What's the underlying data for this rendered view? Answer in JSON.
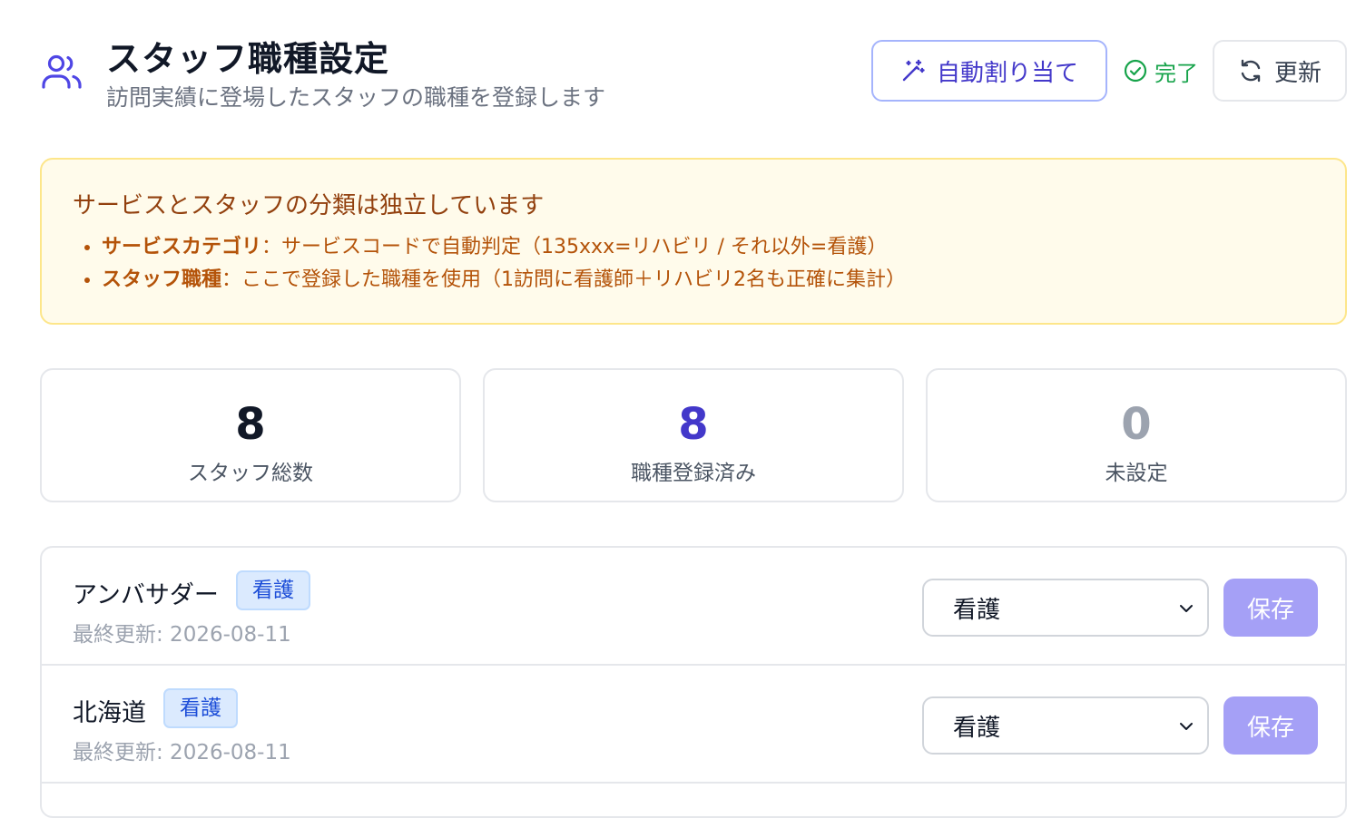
{
  "header": {
    "title": "スタッフ職種設定",
    "subtitle": "訪問実績に登場したスタッフの職種を登録します",
    "auto_assign_label": "自動割り当て",
    "status_text": "完了",
    "refresh_label": "更新"
  },
  "info": {
    "title": "サービスとスタッフの分類は独立しています",
    "items": [
      {
        "term": "サービスカテゴリ",
        "sep": "：",
        "desc": "サービスコードで自動判定（135xxx=リハビリ / それ以外=看護）"
      },
      {
        "term": "スタッフ職種",
        "sep": "：",
        "desc": "ここで登録した職種を使用（1訪問に看護師＋リハビリ2名も正確に集計）"
      }
    ]
  },
  "stats": [
    {
      "value": "8",
      "label": "スタッフ総数",
      "color": "#111827"
    },
    {
      "value": "8",
      "label": "職種登録済み",
      "color": "#4338ca"
    },
    {
      "value": "0",
      "label": "未設定",
      "color": "#9ca3af"
    }
  ],
  "staff": [
    {
      "name": "アンバサダー",
      "badge": "看護",
      "updated": "最終更新: 2026-08-11",
      "selected": "看護",
      "save_label": "保存"
    },
    {
      "name": "北海道",
      "badge": "看護",
      "updated": "最終更新: 2026-08-11",
      "selected": "看護",
      "save_label": "保存"
    }
  ],
  "colors": {
    "accent": "#4f46e5",
    "success": "#16a34a",
    "warning_bg": "#fffbeb",
    "warning_text": "#b45309",
    "save_disabled": "#a5a0f6"
  },
  "icons": {
    "header": "users-icon",
    "auto_assign": "magic-wand-icon",
    "status": "check-circle-icon",
    "refresh": "refresh-icon",
    "select": "chevron-down-icon"
  }
}
